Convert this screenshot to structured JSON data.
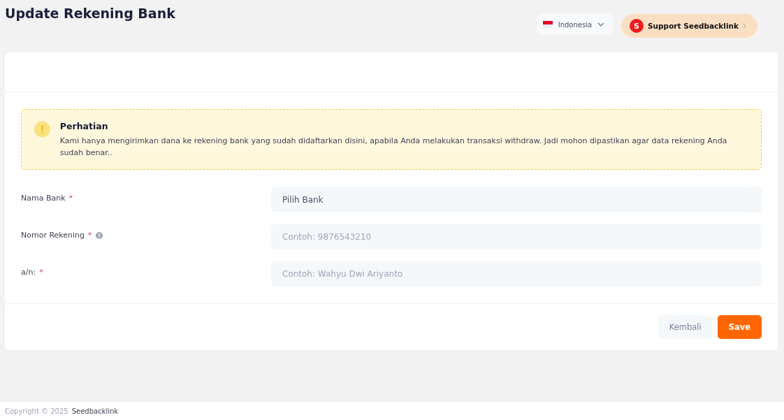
{
  "page_title": "Update Rekening Bank",
  "language": {
    "label": "Indonesia"
  },
  "support": {
    "badge": "S",
    "label": "Support Seedbacklink"
  },
  "notice": {
    "title": "Perhatian",
    "text": "Kami hanya mengirimkan dana ke rekening bank yang sudah didaftarkan disini, apabila Anda melakukan transaksi withdraw. Jadi mohon dipastikan agar data rekening Anda sudah benar.."
  },
  "fields": [
    {
      "label": "Nama Bank",
      "required_mark": "*",
      "info": false,
      "kind": "select",
      "value": "Pilih Bank"
    },
    {
      "label": "Nomor Rekening",
      "required_mark": "*",
      "info": true,
      "kind": "input",
      "placeholder": "Contoh: 9876543210"
    },
    {
      "label": "a/n:",
      "required_mark": "*",
      "info": false,
      "kind": "input",
      "placeholder": "Contoh: Wahyu Dwi Ariyanto"
    }
  ],
  "buttons": [
    {
      "label": "Kembali",
      "kind": "secondary"
    },
    {
      "label": "Save",
      "kind": "primary"
    }
  ],
  "footer": {
    "copyright": "Copyright © 2025",
    "brand": "Seedbacklink"
  }
}
